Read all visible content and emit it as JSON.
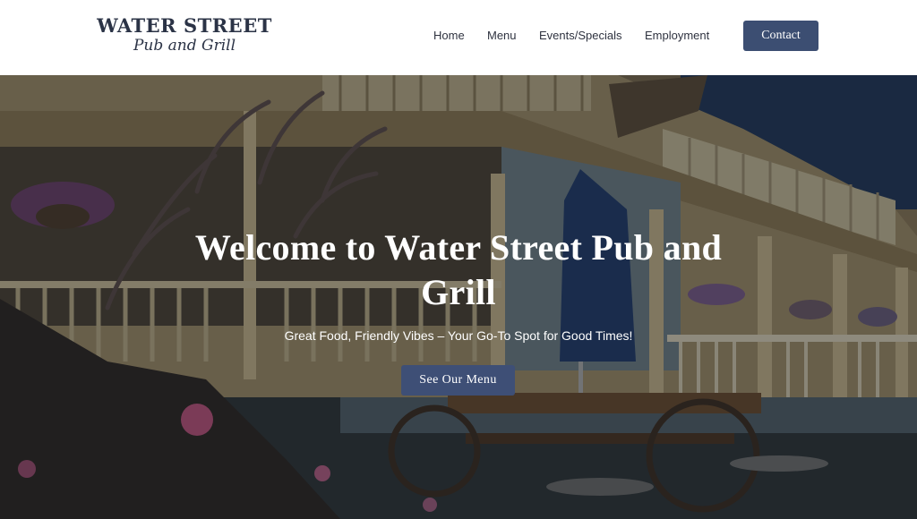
{
  "brand": {
    "name_line1": "WATER STREET",
    "name_line2": "Pub and Grill"
  },
  "nav": {
    "items": [
      {
        "label": "Home"
      },
      {
        "label": "Menu"
      },
      {
        "label": "Events/Specials"
      },
      {
        "label": "Employment"
      }
    ],
    "contact_label": "Contact"
  },
  "hero": {
    "title": "Welcome to Water Street Pub and Grill",
    "subtitle": "Great Food, Friendly Vibes – Your Go-To Spot for Good Times!",
    "cta_label": "See Our Menu",
    "background_image": "pub-exterior-porch-photo"
  },
  "colors": {
    "brand_navy": "#2b3346",
    "button_blue": "#3c4e72",
    "nav_text": "#2f3340",
    "header_bg": "#ffffff",
    "hero_text": "#ffffff"
  }
}
